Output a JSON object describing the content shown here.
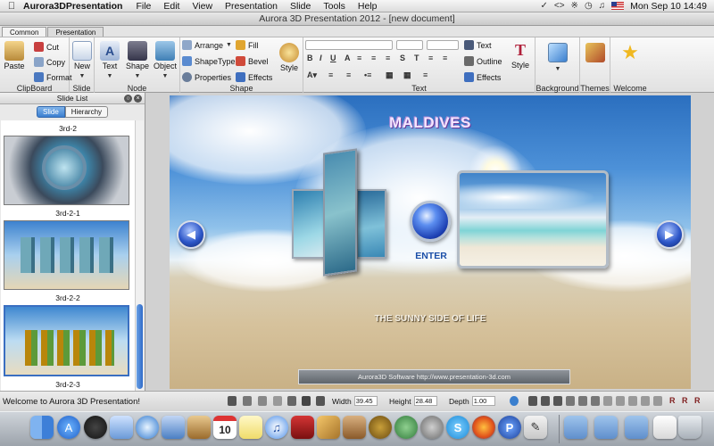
{
  "menubar": {
    "app_name": "Aurora3DPresentation",
    "items": [
      "File",
      "Edit",
      "View",
      "Presentation",
      "Slide",
      "Tools",
      "Help"
    ],
    "clock": "Mon Sep 10  14:49",
    "status_icons": [
      "sync-icon",
      "code-icon",
      "bluetooth-icon",
      "clock-icon",
      "volume-icon",
      "flag-icon"
    ]
  },
  "window": {
    "title": "Aurora 3D Presentation 2012 - [new document]"
  },
  "ribbon_tabs": [
    "Common",
    "Presentation"
  ],
  "ribbon": {
    "clipboard": {
      "title": "ClipBoard",
      "paste": "Paste",
      "cut": "Cut",
      "copy": "Copy",
      "format": "Format"
    },
    "slide": {
      "title": "Slide",
      "new": "New"
    },
    "node": {
      "title": "Node",
      "text": "Text",
      "shape": "Shape",
      "object": "Object"
    },
    "shape": {
      "title": "Shape",
      "arrange": "Arrange",
      "shapetype": "ShapeType",
      "properties": "Properties",
      "fill": "Fill",
      "bevel": "Bevel",
      "effects": "Effects",
      "style": "Style"
    },
    "text": {
      "title": "Text",
      "text": "Text",
      "outline": "Outline",
      "effects": "Effects",
      "style": "Style"
    },
    "background": {
      "title": "Background"
    },
    "themes": {
      "title": "Themes"
    },
    "welcome": {
      "title": "Welcome"
    }
  },
  "slide_panel": {
    "title": "Slide List",
    "tabs": [
      "Slide",
      "Hierarchy"
    ],
    "slides": [
      {
        "label": "3rd-2"
      },
      {
        "label": "3rd-2-1"
      },
      {
        "label": "3rd-2-2"
      },
      {
        "label": "3rd-2-3"
      }
    ]
  },
  "slide": {
    "title": "MALDIVES",
    "enter_label": "ENTER",
    "subtitle": "THE SUNNY SIDE OF LIFE",
    "footer": "Aurora3D Software   http://www.presentation-3d.com"
  },
  "statusbar": {
    "welcome": "Welcome to Aurora 3D Presentation!",
    "width_label": "Width",
    "width_value": "39.45",
    "height_label": "Height",
    "height_value": "28.48",
    "depth_label": "Depth",
    "depth_value": "1.00"
  },
  "dock": {
    "icons": [
      "finder-icon",
      "appstore-icon",
      "dashboard-icon",
      "preview-icon",
      "safari-icon",
      "facetime-icon",
      "contacts-icon",
      "calendar-icon",
      "notes-icon",
      "itunes-icon",
      "photobooth-icon",
      "iphoto-icon",
      "garageband-icon",
      "timemachine-icon",
      "systemprefs-icon",
      "skype-icon",
      "firefox-icon",
      "aurora-icon",
      "textedit-icon",
      "folder-icon",
      "downloads-icon",
      "trash-icon"
    ],
    "calendar_day": "10"
  }
}
